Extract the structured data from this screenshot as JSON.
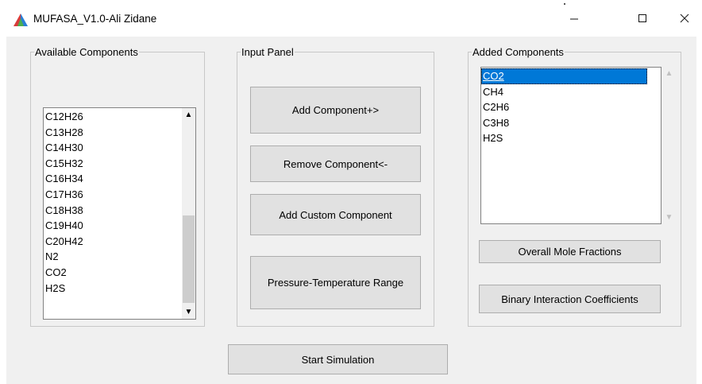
{
  "window": {
    "title": "MUFASA_V1.0-Ali Zidane",
    "minimize_glyph": "—",
    "maximize_glyph": "☐",
    "close_glyph": "✕",
    "app_icon": "tri-color-triangle-icon",
    "icon_colors": [
      "#d83b3b",
      "#2a7fd6",
      "#4caf50"
    ]
  },
  "available": {
    "label": "Available Components",
    "items": [
      "C12H26",
      "C13H28",
      "C14H30",
      "C15H32",
      "C16H34",
      "C17H36",
      "C18H38",
      "C19H40",
      "C20H42",
      "N2",
      "CO2",
      "H2S"
    ],
    "scroll_up": "▲",
    "scroll_down": "▼"
  },
  "input_panel": {
    "label": "Input Panel",
    "add_component": "Add Component+>",
    "remove_component": "Remove Component<-",
    "add_custom": "Add Custom Component",
    "pt_range": "Pressure-Temperature Range"
  },
  "added": {
    "label": "Added Components",
    "items": [
      "CO2",
      "CH4",
      "C2H6",
      "C3H8",
      "H2S"
    ],
    "selected": "CO2",
    "overall_mole_fractions": "Overall Mole Fractions",
    "binary_interaction": "Binary Interaction Coefficients",
    "scroll_up": "▲",
    "scroll_down": "▼"
  },
  "start_simulation": "Start Simulation",
  "colors": {
    "selection": "#0078d7",
    "button_face": "#e1e1e1",
    "client_bg": "#f0f0f0"
  }
}
